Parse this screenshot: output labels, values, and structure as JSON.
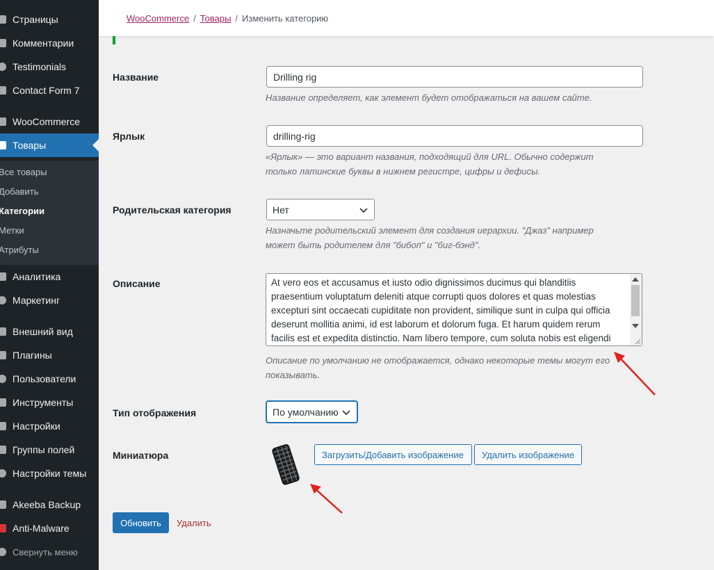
{
  "sidebar": {
    "items_top": [
      {
        "label": "Страницы",
        "icon": "pages-icon"
      },
      {
        "label": "Комментарии",
        "icon": "comments-icon"
      },
      {
        "label": "Testimonials",
        "icon": "testimonials-icon"
      },
      {
        "label": "Contact Form 7",
        "icon": "contact-form-icon"
      },
      {
        "label": "WooCommerce",
        "icon": "woocommerce-icon"
      },
      {
        "label": "Товары",
        "icon": "products-icon"
      }
    ],
    "submenu": [
      {
        "label": "Все товары"
      },
      {
        "label": "Добавить"
      },
      {
        "label": "Категории"
      },
      {
        "label": "Метки"
      },
      {
        "label": "Атрибуты"
      }
    ],
    "items_bottom": [
      {
        "label": "Аналитика",
        "icon": "analytics-icon"
      },
      {
        "label": "Маркетинг",
        "icon": "marketing-icon"
      },
      {
        "label": "Внешний вид",
        "icon": "appearance-icon"
      },
      {
        "label": "Плагины",
        "icon": "plugins-icon"
      },
      {
        "label": "Пользователи",
        "icon": "users-icon"
      },
      {
        "label": "Инструменты",
        "icon": "tools-icon"
      },
      {
        "label": "Настройки",
        "icon": "settings-icon"
      },
      {
        "label": "Группы полей",
        "icon": "field-groups-icon"
      },
      {
        "label": "Настройки темы",
        "icon": "theme-settings-icon"
      },
      {
        "label": "Akeeba Backup",
        "icon": "akeeba-icon"
      },
      {
        "label": "Anti-Malware",
        "icon": "anti-malware-icon"
      }
    ],
    "collapse_label": "Свернуть меню"
  },
  "breadcrumb": {
    "woocommerce": "WooCommerce",
    "products": "Товары",
    "current": "Изменить категорию",
    "separator": "/"
  },
  "form": {
    "name": {
      "label": "Название",
      "value": "Drilling rig",
      "description": "Название определяет, как элемент будет отображаться на вашем сайте."
    },
    "slug": {
      "label": "Ярлык",
      "value": "drilling-rig",
      "description_line1": "«Ярлык» — это вариант названия, подходящий для URL. Обычно содержит",
      "description_line2": "только латинские буквы в нижнем регистре, цифры и дефисы."
    },
    "parent": {
      "label": "Родительская категория",
      "selected": "Нет",
      "description_line1": "Назначьте родительский элемент для создания иерархии. \"Джаз\" например",
      "description_line2": "может быть родителем для \"бибоп\" и \"биг-бэнд\"."
    },
    "description": {
      "label": "Описание",
      "lines": [
        "At vero eos et accusamus et iusto odio dignissimos ducimus qui blanditiis",
        "praesentium voluptatum deleniti atque corrupti quos dolores et quas molestias",
        "excepturi sint occaecati cupiditate non provident, similique sunt in culpa qui officia",
        "deserunt mollitia animi, id est laborum et dolorum fuga. Et harum quidem rerum",
        "facilis est et expedita distinctio. Nam libero tempore, cum soluta nobis est eligendi"
      ],
      "help_line1": "Описание по умолчанию не отображается, однако некоторые темы могут его",
      "help_line2": "показывать."
    },
    "display_type": {
      "label": "Тип отображения",
      "selected": "По умолчанию"
    },
    "thumbnail": {
      "label": "Миниатюра",
      "upload_button": "Загрузить/Добавить изображение",
      "remove_button": "Удалить изображение"
    },
    "update_button": "Обновить",
    "delete_link": "Удалить"
  },
  "colors": {
    "sidebar_bg": "#1d2327",
    "accent": "#2271b1",
    "link_pink": "#a3235f",
    "delete_red": "#b32d2e",
    "annotation_red": "#e0211a"
  }
}
